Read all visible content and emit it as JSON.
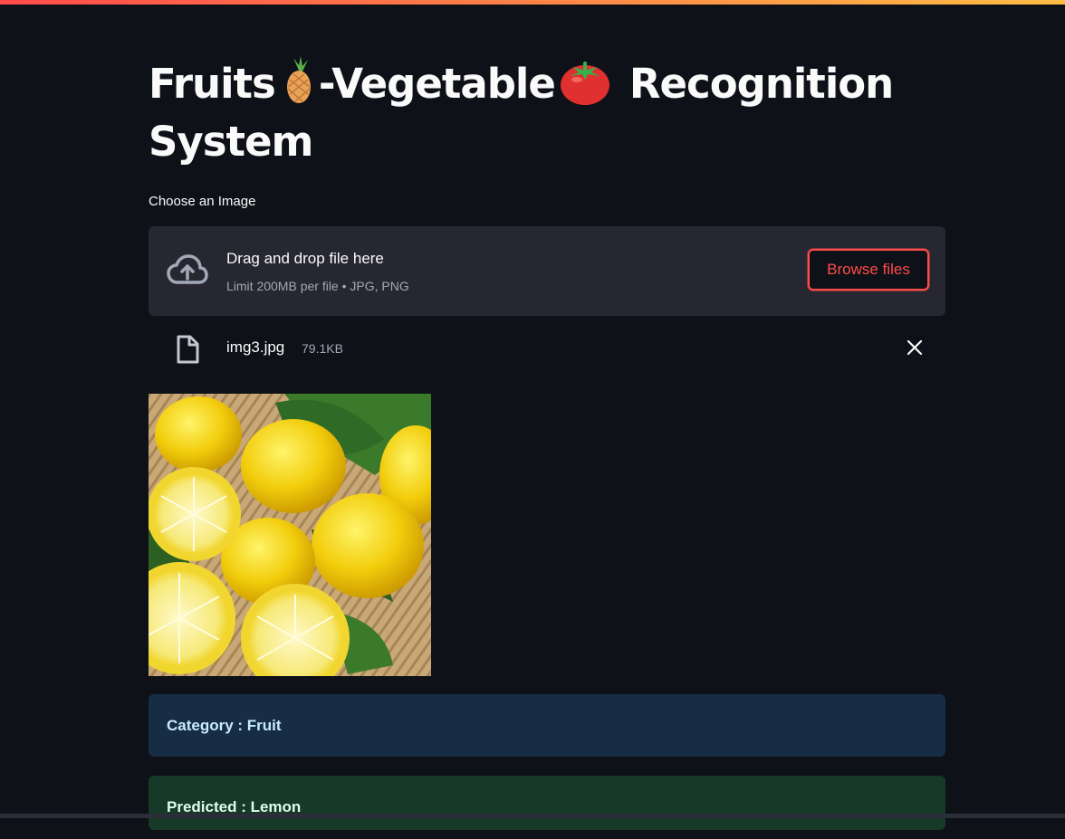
{
  "app": {
    "title_part1": "Fruits",
    "title_part2": "-Vegetable",
    "title_part3": "Recognition System",
    "title_emoji_1": "pineapple-icon",
    "title_emoji_2": "tomato-icon"
  },
  "uploader": {
    "label": "Choose an Image",
    "drop_text": "Drag and drop file here",
    "limit_text": "Limit 200MB per file • JPG, PNG",
    "browse_label": "Browse files",
    "icon": "cloud-upload-icon"
  },
  "file": {
    "name": "img3.jpg",
    "size": "79.1KB",
    "icon": "file-icon",
    "remove_icon": "close-icon"
  },
  "image": {
    "description": "lemons"
  },
  "results": {
    "category": "Category : Fruit",
    "prediction": "Predicted : Lemon"
  },
  "colors": {
    "background": "#0e1117",
    "accent": "#ff4b4b",
    "dropzone": "#262730",
    "info_bg": "#172d43",
    "success_bg": "#173928"
  }
}
